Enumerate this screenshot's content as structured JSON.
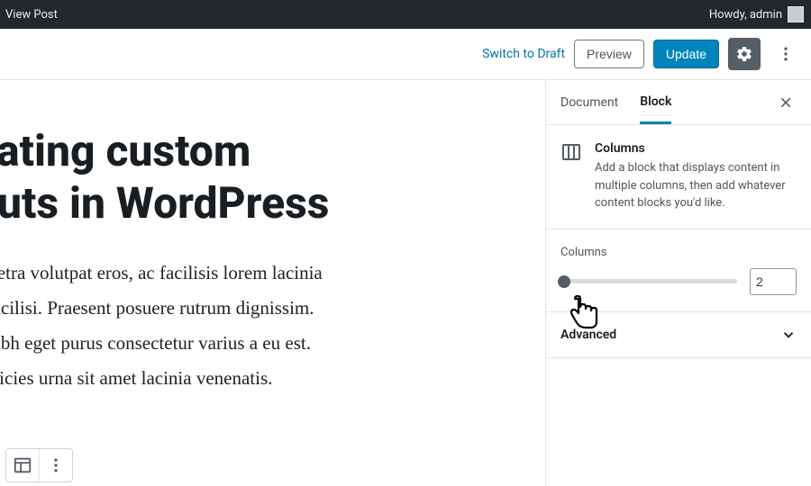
{
  "adminbar": {
    "view_post": "View Post",
    "greeting": "Howdy, admin"
  },
  "topbar": {
    "switch_draft": "Switch to Draft",
    "preview": "Preview",
    "update": "Update"
  },
  "editor": {
    "title_line1": "eating custom",
    "title_line2": "outs in WordPress",
    "p1": "haretra volutpat eros, ac facilisis lorem lacinia",
    "p2": "a facilisi. Praesent posuere rutrum dignissim.",
    "p3": "a nibh eget purus consectetur varius a eu est.",
    "p4": "ultricies urna sit amet lacinia venenatis."
  },
  "sidebar": {
    "tabs": {
      "document": "Document",
      "block": "Block"
    },
    "block_panel": {
      "name": "Columns",
      "desc": "Add a block that displays content in multiple columns, then add whatever content blocks you'd like."
    },
    "columns_control": {
      "label": "Columns",
      "value": "2"
    },
    "advanced": "Advanced"
  }
}
